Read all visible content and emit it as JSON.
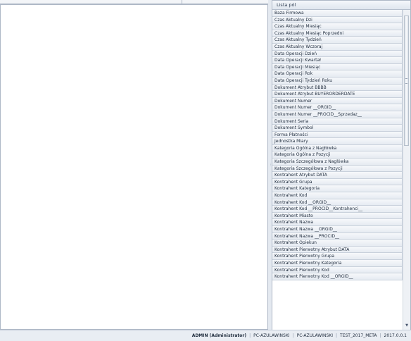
{
  "fields_panel": {
    "title": "Lista pól",
    "items": [
      "Baza Firmowa",
      "Czas Aktualny Dzi",
      "Czas Aktualny Miesiąc",
      "Czas Aktualny Miesiąc Poprzedni",
      "Czas Aktualny Tydzień",
      "Czas Aktualny Wczoraj",
      "Data Operacji Dzień",
      "Data Operacji Kwartał",
      "Data Operacji Miesiąc",
      "Data Operacji Rok",
      "Data Operacji Tydzień Roku",
      "Dokument Atrybut BBBB",
      "Dokument Atrybut BUYERORDERDATE",
      "Dokument Numer",
      "Dokument Numer __ORGID__",
      "Dokument Numer __PROCID__Sprzedaz__",
      "Dokument Seria",
      "Dokument Symbol",
      "Forma Płatności",
      "Jednostka Miary",
      "Kategoria Ogólna z Nagłówka",
      "Kategoria Ogólna z Pozycji",
      "Kategoria Szczegółowa z Nagłówka",
      "Kategoria Szczegółowa z Pozycji",
      "Kontrahent Atrybut DATA",
      "Kontrahent Grupa",
      "Kontrahent Kategoria",
      "Kontrahent Kod",
      "Kontrahent Kod __ORGID__",
      "Kontrahent Kod __PROCID__Kontrahenci__",
      "Kontrahent Miasto",
      "Kontrahent Nazwa",
      "Kontrahent Nazwa __ORGID__",
      "Kontrahent Nazwa __PROCID__",
      "Kontrahent Opiekun",
      "Kontrahent Pierwotny Atrybut DATA",
      "Kontrahent Pierwotny Grupa",
      "Kontrahent Pierwotny Kategoria",
      "Kontrahent Pierwotny Kod",
      "Kontrahent Pierwotny Kod __ORGID__"
    ]
  },
  "status_bar": {
    "user": "ADMIN (Administrator)",
    "computer": "PC-AZULAWINSKI",
    "server": "PC-AZULAWINSKI",
    "database": "TEST_2017_META",
    "version": "2017.0.0.1"
  },
  "icons": {
    "scroll_down": "chevron-down-icon",
    "splitter_grip": "grip-icon"
  }
}
